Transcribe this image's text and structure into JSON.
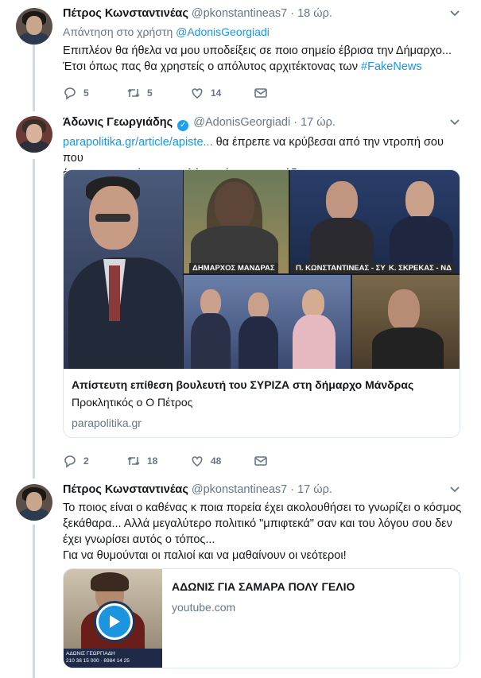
{
  "tweets": [
    {
      "name": "Πέτρος Κωνσταντινέας",
      "handle": "@pkonstantineas7",
      "time": "· 18 ώρ.",
      "reply_prefix": "Απάντηση στο χρήστη",
      "reply_user": "@AdonisGeorgiadi",
      "line1": "Επιπλέον θα ήθελα να μου υποδείξεις σε ποιο σημείο έβρισα την Δήμαρχο...",
      "line2": "Έτσι όπως πας θα χρηστείς ο απόλυτος αρχιτέκτονας των",
      "hashtag": "#FakeNews",
      "replies": "5",
      "retweets": "5",
      "likes": "14"
    },
    {
      "name": "Άδωνις Γεωργιάδης",
      "handle": "@AdonisGeorgiadi",
      "time": "· 17 ώρ.",
      "link": "parapolitika.gr/article/apiste...",
      "line1_rest": " θα έπρεπε να κρύβεσαι από την ντροπή σου που",
      "line2": "έχεις και τα μούτρα να μιλάς με ύφος! Απαράδεκτε!",
      "card": {
        "title": "Απίστευτη επίθεση βουλευτή του ΣΥΡΙΖΑ στη δήμαρχο Μάνδρας",
        "description": "Προκλητικός ο Ο Πέτρος",
        "domain": "parapolitika.gr",
        "tag_mayor": "ΔΗΜΑΡΧΟΣ ΜΑΝΔΡΑΣ",
        "tag_mp": "Π. ΚΩΝΣΤΑΝΤΙΝΕΑΣ - ΣΥΡΙΖΑ",
        "tag_nd": "Κ. ΣΚΡΕΚΑΣ - ΝΔ"
      },
      "replies": "2",
      "retweets": "18",
      "likes": "48"
    },
    {
      "name": "Πέτρος Κωνσταντινέας",
      "handle": "@pkonstantineas7",
      "time": "· 17 ώρ.",
      "line1": "Το ποιος είναι ο καθένας κ ποια πορεία έχει ακολουθήσει το γνωρίζει ο κόσμος",
      "line2": "ξεκάθαρα... Αλλά μεγαλύτερο πολιτικό \"μπιφτεκά\" σαν και του λόγου σου δεν",
      "line3": "έχει γνωρίσει αυτός ο τόπος...",
      "line4": "Για να θυμούνται οι παλιοί και να μαθαίνουν οι νεότεροι!",
      "card": {
        "title": "ΑΔΩΝΙΣ ΓΙΑ ΣΑΜΑΡΑ ΠΟΛΥ ΓΕΛΙΟ",
        "domain": "youtube.com",
        "caption": "ΑΔΩΝΙΣ ΓΕΩΡΓΙΑΔΗ",
        "phone": "210 38 15 000 · 6984 14 25"
      }
    }
  ],
  "colors": {
    "link": "#1b95e0",
    "muted": "#657786",
    "thread": "#c4dcee",
    "verified": "#1da1f2"
  }
}
